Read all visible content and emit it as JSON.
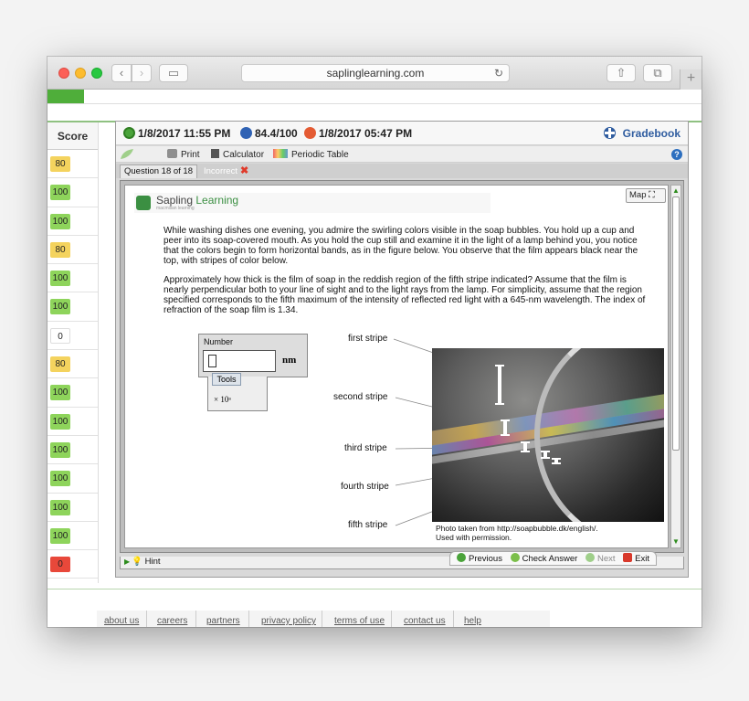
{
  "browser": {
    "url": "saplinglearning.com",
    "back_icon": "‹",
    "forward_icon": "›",
    "sidebar_icon": "▭",
    "share_icon": "⇧",
    "tabs_icon": "⧉",
    "new_tab_icon": "+",
    "reload_icon": "↻"
  },
  "scores": {
    "header": "Score",
    "items": [
      {
        "value": "80",
        "color": "#f4d35e"
      },
      {
        "value": "100",
        "color": "#8ed45b"
      },
      {
        "value": "100",
        "color": "#8ed45b"
      },
      {
        "value": "80",
        "color": "#f4d35e"
      },
      {
        "value": "100",
        "color": "#8ed45b"
      },
      {
        "value": "100",
        "color": "#8ed45b"
      },
      {
        "value": "0",
        "color": "#ffffff"
      },
      {
        "value": "80",
        "color": "#f4d35e"
      },
      {
        "value": "100",
        "color": "#8ed45b"
      },
      {
        "value": "100",
        "color": "#8ed45b"
      },
      {
        "value": "100",
        "color": "#8ed45b"
      },
      {
        "value": "100",
        "color": "#8ed45b"
      },
      {
        "value": "100",
        "color": "#8ed45b"
      },
      {
        "value": "100",
        "color": "#8ed45b"
      },
      {
        "value": "0",
        "color": "#e8483a"
      }
    ]
  },
  "info": {
    "due_date": "1/8/2017 11:55 PM",
    "score": "84.4/100",
    "late_date": "1/8/2017 05:47 PM",
    "gradebook": "Gradebook"
  },
  "toolbar": {
    "print": "Print",
    "calculator": "Calculator",
    "periodic_table": "Periodic Table",
    "help": "?"
  },
  "question_tabs": {
    "current": "Question 18 of 18",
    "status": "Incorrect",
    "status_icon": "✖"
  },
  "question": {
    "brand": "Sapling",
    "brand_accent": "Learning",
    "brand_sub": "macmillan learning",
    "map_label": "Map",
    "paragraph1": "While washing dishes one evening, you admire the swirling colors visible in the soap bubbles. You hold up a cup and peer into its soap-covered mouth. As you hold the cup still and examine it in the light of a lamp behind you, you notice that the colors begin to form horizontal bands, as in the figure below. You observe that the film appears black near the top, with stripes of color below.",
    "paragraph2": "Approximately how thick is the film of soap in the reddish region of the fifth stripe indicated? Assume that the film is nearly perpendicular both to your line of sight and to the light rays from the lamp. For simplicity, assume that the region specified corresponds to the fifth maximum of the intensity of reflected red light with a 645-nm wavelength. The index of refraction of the soap film is 1.34.",
    "answer_label": "Number",
    "answer_value": "",
    "unit": "nm",
    "tools_label": "Tools",
    "sci_notation": "× 10ᵃ",
    "stripes": [
      "first stripe",
      "second stripe",
      "third stripe",
      "fourth stripe",
      "fifth stripe"
    ],
    "caption_line1": "Photo taken from http://soapbubble.dk/english/.",
    "caption_line2": "Used with permission."
  },
  "bottom": {
    "hint": "Hint",
    "previous": "Previous",
    "check_answer": "Check Answer",
    "next": "Next",
    "exit": "Exit"
  },
  "footer": {
    "links": [
      "about us",
      "careers",
      "partners",
      "privacy policy",
      "terms of use",
      "contact us",
      "help"
    ]
  }
}
